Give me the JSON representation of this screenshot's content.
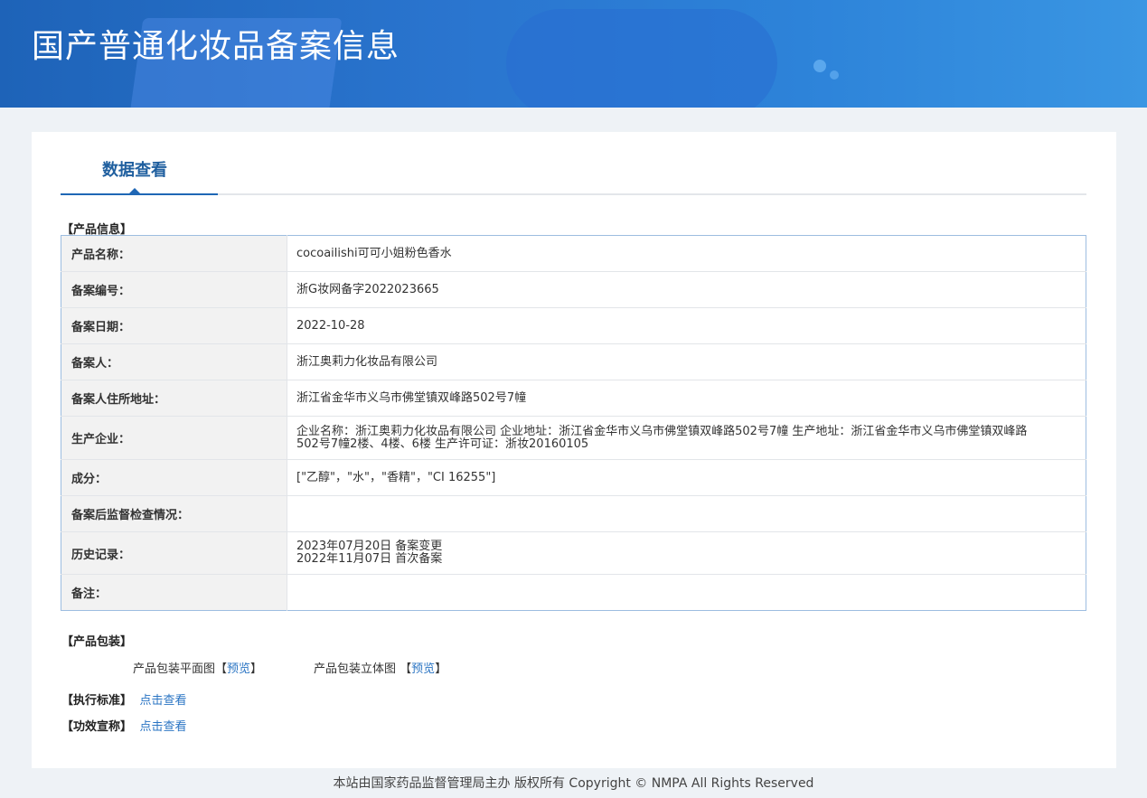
{
  "header": {
    "title": "国产普通化妆品备案信息"
  },
  "tabs": [
    {
      "label": "数据查看"
    }
  ],
  "product_info": {
    "section_title": "【产品信息】",
    "rows": [
      {
        "label": "产品名称：",
        "value": "cocoailishi可可小姐粉色香水"
      },
      {
        "label": "备案编号：",
        "value": "浙G妆网备字2022023665"
      },
      {
        "label": "备案日期：",
        "value": "2022-10-28"
      },
      {
        "label": "备案人：",
        "value": "浙江奥莉力化妆品有限公司"
      },
      {
        "label": "备案人住所地址：",
        "value": "浙江省金华市义乌市佛堂镇双峰路502号7幢"
      },
      {
        "label": "生产企业：",
        "value": "企业名称：浙江奥莉力化妆品有限公司 企业地址：浙江省金华市义乌市佛堂镇双峰路502号7幢 生产地址：浙江省金华市义乌市佛堂镇双峰路502号7幢2楼、4楼、6楼 生产许可证：浙妆20160105"
      },
      {
        "label": "成分：",
        "value": "[\"乙醇\"，\"水\"，\"香精\"，\"CI 16255\"]"
      },
      {
        "label": "备案后监督检查情况：",
        "value": ""
      },
      {
        "label": "历史记录：",
        "value_lines": [
          "2023年07月20日 备案变更",
          "2022年11月07日 首次备案"
        ]
      },
      {
        "label": "备注：",
        "value": ""
      }
    ]
  },
  "packaging": {
    "section_title": "【产品包装】",
    "flat_label": "产品包装平面图",
    "solid_label": "产品包装立体图",
    "preview_label": "预览",
    "open_bracket": "【",
    "close_bracket": "】"
  },
  "standard": {
    "section_title": "【执行标准】",
    "link": "点击查看"
  },
  "efficacy": {
    "section_title": "【功效宣称】",
    "link": "点击查看"
  },
  "footer": {
    "text": "本站由国家药品监督管理局主办 版权所有 Copyright © NMPA All Rights Reserved"
  }
}
